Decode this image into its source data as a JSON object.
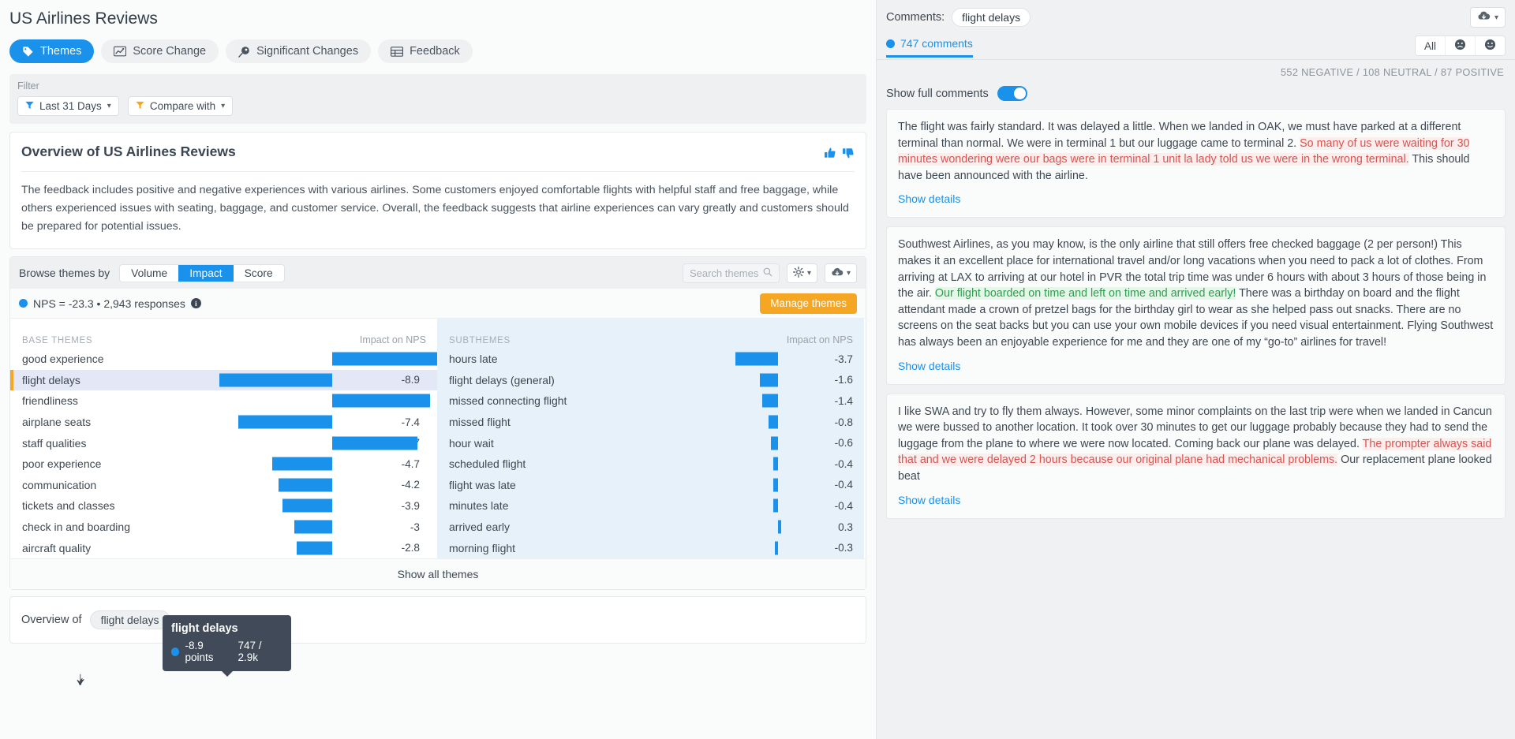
{
  "header": {
    "title": "US Airlines Reviews",
    "tabs": [
      {
        "label": "Themes",
        "icon": "tag-icon",
        "active": true
      },
      {
        "label": "Score Change",
        "icon": "chart-line-icon",
        "active": false
      },
      {
        "label": "Significant Changes",
        "icon": "comet-icon",
        "active": false
      },
      {
        "label": "Feedback",
        "icon": "table-icon",
        "active": false
      }
    ]
  },
  "filter": {
    "label": "Filter",
    "chips": [
      {
        "label": "Last 31 Days",
        "icon": "filter-icon-blue"
      },
      {
        "label": "Compare with",
        "icon": "filter-icon-orange"
      }
    ]
  },
  "overview": {
    "title": "Overview of US Airlines Reviews",
    "body": "The feedback includes positive and negative experiences with various airlines. Some customers enjoyed comfortable flights with helpful staff and free baggage, while others experienced issues with seating, baggage, and customer service. Overall, the feedback suggests that airline experiences can vary greatly and customers should be prepared for potential issues.",
    "thumb_up": "👍",
    "thumb_down": "👎"
  },
  "browse": {
    "label": "Browse themes by",
    "options": [
      "Volume",
      "Impact",
      "Score"
    ],
    "selected": "Impact",
    "search_placeholder": "Search themes",
    "settings_icon": "gear-icon",
    "download_icon": "cloud-download-icon"
  },
  "nps": {
    "text": "NPS = -23.3 • 2,943 responses",
    "info_icon": "info-icon",
    "manage_label": "Manage themes",
    "accent": "#f5a623"
  },
  "tooltip": {
    "title": "flight delays",
    "points": "-8.9 points",
    "count": "747 / 2.9k"
  },
  "table": {
    "base_header": "BASE THEMES",
    "sub_header": "SUBTHEMES",
    "impact_header": "Impact on NPS",
    "show_all": "Show all themes"
  },
  "chart_data": {
    "type": "bar",
    "title": "Impact on NPS",
    "xlabel": "Impact on NPS",
    "ylabel": "",
    "series": [
      {
        "name": "BASE THEMES",
        "categories": [
          "good experience",
          "flight delays",
          "friendliness",
          "airplane seats",
          "staff qualities",
          "poor experience",
          "communication",
          "tickets and classes",
          "check in and boarding",
          "aircraft quality"
        ],
        "values": [
          10.1,
          -8.9,
          7.7,
          -7.4,
          6.7,
          -4.7,
          -4.2,
          -3.9,
          -3,
          -2.8
        ]
      },
      {
        "name": "SUBTHEMES",
        "categories": [
          "hours late",
          "flight delays (general)",
          "missed connecting flight",
          "missed flight",
          "hour wait",
          "scheduled flight",
          "flight was late",
          "minutes late",
          "arrived early",
          "morning flight"
        ],
        "values": [
          -3.7,
          -1.6,
          -1.4,
          -0.8,
          -0.6,
          -0.4,
          -0.4,
          -0.4,
          0.3,
          -0.3
        ]
      }
    ],
    "selected_category": "flight delays",
    "bar_color": "#1a91eb"
  },
  "bottom": {
    "prefix": "Overview of",
    "theme": "flight delays"
  },
  "comments_panel": {
    "label": "Comments:",
    "theme_pill": "flight delays",
    "download_icon": "cloud-download-icon",
    "tab_label": "747 comments",
    "sentiment_filters": [
      "All",
      "☹",
      "☺"
    ],
    "stats": "552 NEGATIVE / 108 NEUTRAL / 87 POSITIVE",
    "toggle_label": "Show full comments",
    "toggle_on": true,
    "show_details": "Show details",
    "comments": [
      {
        "parts": [
          {
            "text": "The flight was fairly standard. It was delayed a little. When we landed in OAK, we must have parked at a different terminal than normal. We were in terminal 1 but our luggage came to terminal 2. ",
            "hl": "none"
          },
          {
            "text": "So many of us were waiting for 30 minutes wondering were our bags were in terminal 1 unit la lady told us we were in the wrong terminal.",
            "hl": "neg"
          },
          {
            "text": " This should have been announced with the airline.",
            "hl": "none"
          }
        ]
      },
      {
        "parts": [
          {
            "text": "Southwest Airlines, as you may know, is the only airline that still offers free checked baggage (2 per person!) This makes it an excellent place for international travel and/or long vacations when you need to pack a lot of clothes. From arriving at LAX to arriving at our hotel in PVR the total trip time was under 6 hours with about 3 hours of those being in the air. ",
            "hl": "none"
          },
          {
            "text": "Our flight boarded on time and left on time and arrived early!",
            "hl": "pos"
          },
          {
            "text": " There was a birthday on board and the flight attendant made a crown of pretzel bags for the birthday girl to wear as she helped pass out snacks. There are no screens on the seat backs but you can use your own mobile devices if you need visual entertainment. Flying Southwest has always been an enjoyable experience for me and they are one of my “go-to” airlines for travel!",
            "hl": "none"
          }
        ]
      },
      {
        "parts": [
          {
            "text": "I like SWA and try to fly them always. However, some minor complaints on the last trip were when we landed in Cancun we were bussed to another location. It took over 30 minutes to get our luggage probably because they had to send the luggage from the plane to where we were now located. Coming back our plane was delayed. ",
            "hl": "none"
          },
          {
            "text": "The prompter always said that and we were delayed 2 hours because our original plane had mechanical problems.",
            "hl": "neg"
          },
          {
            "text": " Our replacement plane looked beat",
            "hl": "none"
          }
        ]
      }
    ]
  }
}
